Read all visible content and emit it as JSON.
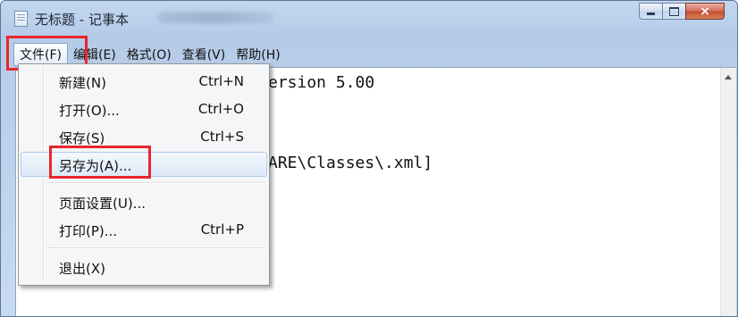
{
  "window": {
    "title": "无标题 - 记事本",
    "controls": {
      "minimize": "minimize",
      "maximize": "maximize",
      "close": "×"
    }
  },
  "menubar": {
    "items": [
      {
        "label": "文件(F)"
      },
      {
        "label": "编辑(E)"
      },
      {
        "label": "格式(O)"
      },
      {
        "label": "查看(V)"
      },
      {
        "label": "帮助(H)"
      }
    ]
  },
  "editor": {
    "lines": [
      "ersion 5.00",
      "ARE\\Classes\\.xml]"
    ]
  },
  "file_menu": {
    "items": [
      {
        "label": "新建(N)",
        "shortcut": "Ctrl+N"
      },
      {
        "label": "打开(O)...",
        "shortcut": "Ctrl+O"
      },
      {
        "label": "保存(S)",
        "shortcut": "Ctrl+S"
      },
      {
        "label": "另存为(A)...",
        "shortcut": ""
      },
      {
        "label": "页面设置(U)...",
        "shortcut": ""
      },
      {
        "label": "打印(P)...",
        "shortcut": "Ctrl+P"
      },
      {
        "label": "退出(X)",
        "shortcut": ""
      }
    ]
  },
  "colors": {
    "highlight_box": "#e8262a",
    "title_bar": "#b9d1ea",
    "close_button": "#c9533a"
  },
  "icons": {
    "app": "notepad-icon",
    "scroll_up": "arrow-up-icon"
  }
}
